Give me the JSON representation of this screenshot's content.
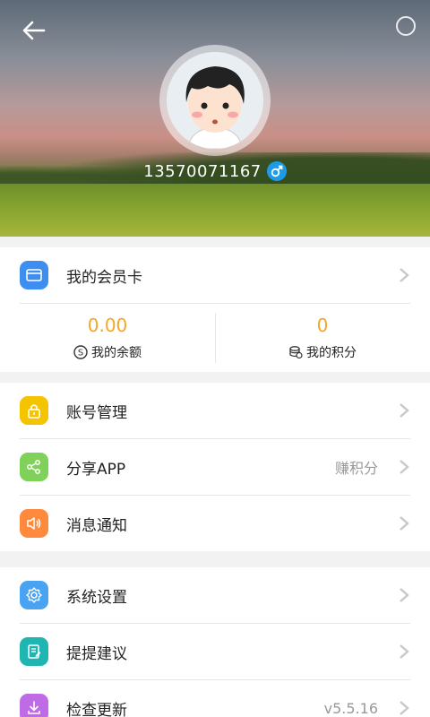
{
  "profile": {
    "phone": "13570071167"
  },
  "member_card": {
    "label": "我的会员卡"
  },
  "balance": {
    "value": "0.00",
    "label": "我的余额"
  },
  "points": {
    "value": "0",
    "label": "我的积分"
  },
  "menu_group1": [
    {
      "label": "账号管理",
      "right": "",
      "icon": "lock-icon",
      "color": "#f5c400"
    },
    {
      "label": "分享APP",
      "right": "赚积分",
      "icon": "share-icon",
      "color": "#7fd15a"
    },
    {
      "label": "消息通知",
      "right": "",
      "icon": "speaker-icon",
      "color": "#ff8a3d"
    }
  ],
  "menu_group2": [
    {
      "label": "系统设置",
      "right": "",
      "icon": "gear-icon",
      "color": "#4aa3f0"
    },
    {
      "label": "提提建议",
      "right": "",
      "icon": "feedback-icon",
      "color": "#1fb5b0"
    },
    {
      "label": "检查更新",
      "right": "v5.5.16",
      "icon": "download-icon",
      "color": "#c06be6"
    }
  ],
  "colors": {
    "accent_orange": "#f5a623",
    "card_blue": "#3d8ef0",
    "gender_blue": "#1e9be6"
  }
}
